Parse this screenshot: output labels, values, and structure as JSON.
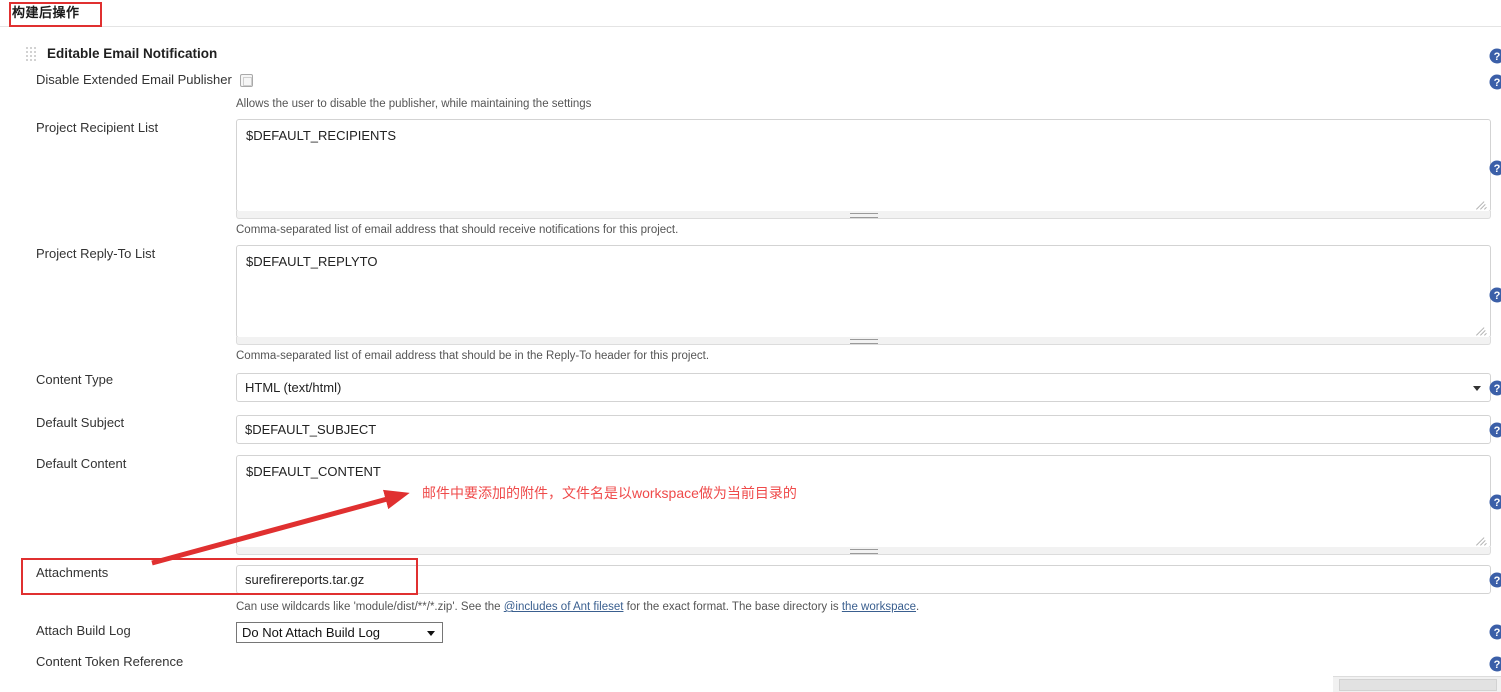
{
  "section": {
    "title": "构建后操作"
  },
  "block": {
    "grip_icon": "drag-grip-icon",
    "title": "Editable Email Notification"
  },
  "fields": {
    "disable_publisher": {
      "label": "Disable Extended Email Publisher",
      "checked": false,
      "help": "Allows the user to disable the publisher, while maintaining the settings"
    },
    "project_recipient_list": {
      "label": "Project Recipient List",
      "value": "$DEFAULT_RECIPIENTS",
      "help": "Comma-separated list of email address that should receive notifications for this project."
    },
    "project_reply_to_list": {
      "label": "Project Reply-To List",
      "value": "$DEFAULT_REPLYTO",
      "help": "Comma-separated list of email address that should be in the Reply-To header for this project."
    },
    "content_type": {
      "label": "Content Type",
      "value": "HTML (text/html)"
    },
    "default_subject": {
      "label": "Default Subject",
      "value": "$DEFAULT_SUBJECT"
    },
    "default_content": {
      "label": "Default Content",
      "value": "$DEFAULT_CONTENT"
    },
    "attachments": {
      "label": "Attachments",
      "value": "surefirereports.tar.gz",
      "help_pre": "Can use wildcards like 'module/dist/**/*.zip'. See the ",
      "help_link1": "@includes of Ant fileset",
      "help_mid": " for the exact format. The base directory is ",
      "help_link2": "the workspace",
      "help_post": "."
    },
    "attach_build_log": {
      "label": "Attach Build Log",
      "value": "Do Not Attach Build Log"
    },
    "content_token_reference": {
      "label": "Content Token Reference"
    }
  },
  "help_icons": {
    "name": "help-question-icon",
    "color": "#3b5fa8"
  },
  "annotations": {
    "box_section_label": "构建后操作",
    "box_attachments": "Attachments",
    "callout_text": "邮件中要添加的附件，文件名是以workspace做为当前目录的",
    "color": "#e03030"
  },
  "scrollbar": {
    "name": "horizontal-scrollbar"
  }
}
